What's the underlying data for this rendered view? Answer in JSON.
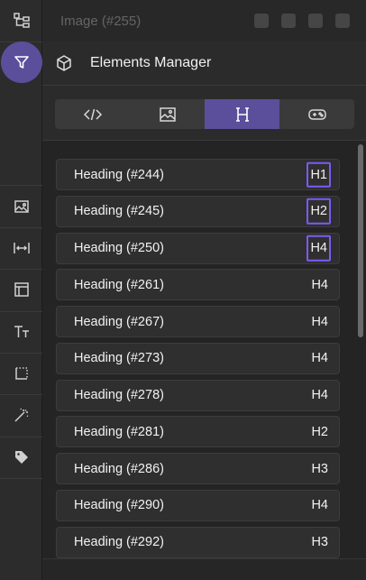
{
  "background_bar": {
    "title": "Image (#255)"
  },
  "panel": {
    "title": "Elements Manager"
  },
  "tabs": [
    {
      "name": "code",
      "icon": "code-icon"
    },
    {
      "name": "image",
      "icon": "image-icon"
    },
    {
      "name": "heading",
      "icon": "heading-icon",
      "label": "H"
    },
    {
      "name": "controls",
      "icon": "gamepad-icon"
    }
  ],
  "rows": [
    {
      "label": "Heading (#244)",
      "tag": "H1"
    },
    {
      "label": "Heading (#245)",
      "tag": "H2"
    },
    {
      "label": "Heading (#250)",
      "tag": "H4"
    },
    {
      "label": "Heading (#261)",
      "tag": "H4"
    },
    {
      "label": "Heading (#267)",
      "tag": "H4"
    },
    {
      "label": "Heading (#273)",
      "tag": "H4"
    },
    {
      "label": "Heading (#278)",
      "tag": "H4"
    },
    {
      "label": "Heading (#281)",
      "tag": "H2"
    },
    {
      "label": "Heading (#286)",
      "tag": "H3"
    },
    {
      "label": "Heading (#290)",
      "tag": "H4"
    },
    {
      "label": "Heading (#292)",
      "tag": "H3"
    }
  ],
  "colors": {
    "accent": "#5b4f9c",
    "highlight_border": "#7b5cf5"
  }
}
